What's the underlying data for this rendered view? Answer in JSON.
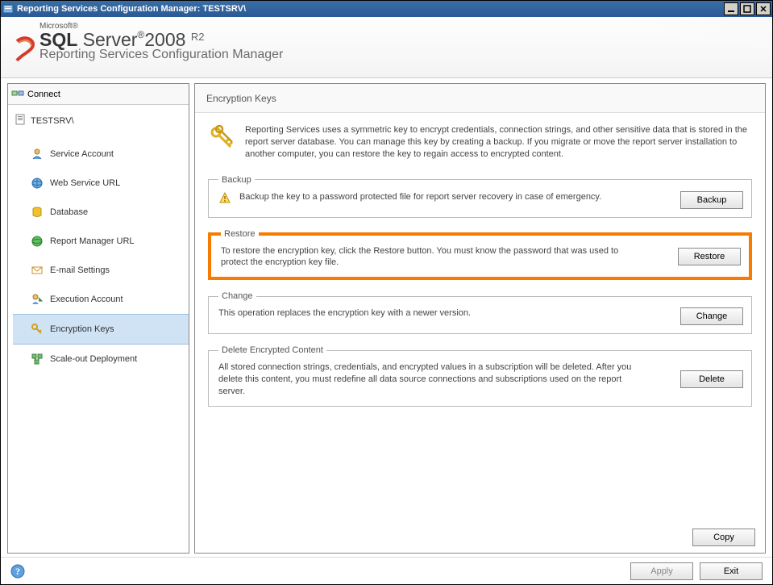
{
  "titlebar": {
    "title": "Reporting Services Configuration Manager: TESTSRV\\"
  },
  "header": {
    "microsoft": "Microsoft®",
    "sql_pre": "SQL",
    "sql_mid": "Server",
    "sql_year": "2008",
    "sql_r2": "R2",
    "subtitle": "Reporting Services Configuration Manager"
  },
  "sidebar": {
    "connect_label": "Connect",
    "server_label": "TESTSRV\\",
    "items": [
      {
        "label": "Service Account"
      },
      {
        "label": "Web Service URL"
      },
      {
        "label": "Database"
      },
      {
        "label": "Report Manager URL"
      },
      {
        "label": "E-mail Settings"
      },
      {
        "label": "Execution Account"
      },
      {
        "label": "Encryption Keys"
      },
      {
        "label": "Scale-out Deployment"
      }
    ]
  },
  "content": {
    "title": "Encryption Keys",
    "intro": "Reporting Services uses a symmetric key to encrypt credentials, connection strings, and other sensitive data that is stored in the report server database.  You can manage this key by creating a backup.  If you migrate or move the report server installation to another computer, you can restore the key to regain access to encrypted content.",
    "groups": {
      "backup": {
        "legend": "Backup",
        "text": "Backup the key to a password protected file for report server recovery in case of emergency.",
        "button": "Backup"
      },
      "restore": {
        "legend": "Restore",
        "text": "To restore the encryption key, click the Restore button.  You must know the password that was used to protect the encryption key file.",
        "button": "Restore"
      },
      "change": {
        "legend": "Change",
        "text": "This operation replaces the encryption key with a newer version.",
        "button": "Change"
      },
      "delete": {
        "legend": "Delete Encrypted Content",
        "text": "All stored connection strings, credentials, and encrypted values in a subscription will be deleted.  After you delete this content, you must redefine all data source connections and subscriptions used on the report server.",
        "button": "Delete"
      }
    },
    "copy_button": "Copy"
  },
  "footer": {
    "apply": "Apply",
    "exit": "Exit"
  }
}
